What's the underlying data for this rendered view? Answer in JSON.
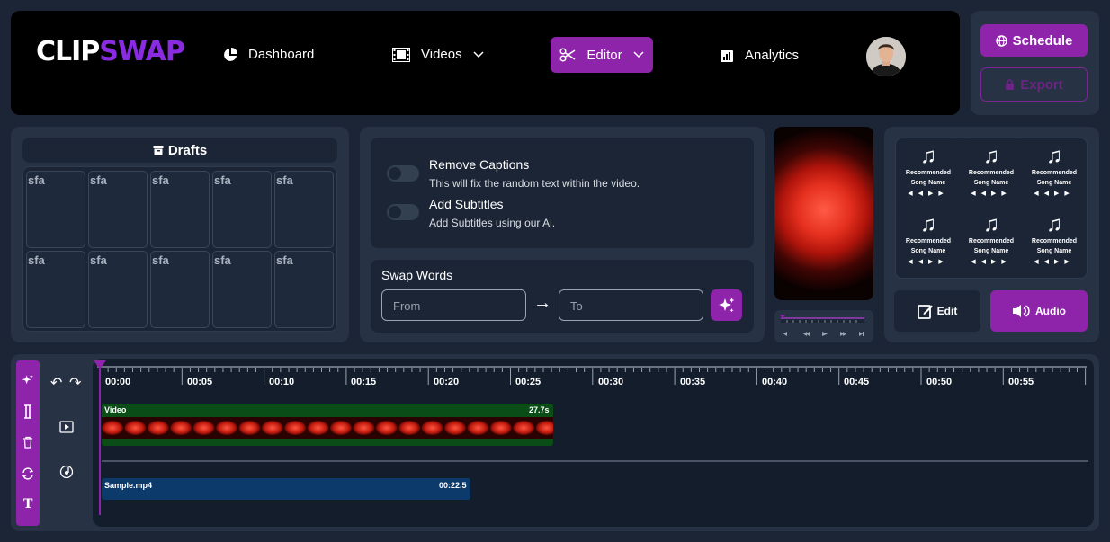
{
  "header": {
    "logo_part1": "CLIP",
    "logo_part2": "SWAP",
    "nav": [
      {
        "label": "Dashboard"
      },
      {
        "label": "Videos"
      },
      {
        "label": "Editor"
      },
      {
        "label": "Analytics"
      }
    ]
  },
  "actions": {
    "schedule_label": "Schedule",
    "export_label": "Export"
  },
  "drafts": {
    "title": "Drafts",
    "items": [
      "sfa",
      "sfa",
      "sfa",
      "sfa",
      "sfa",
      "sfa",
      "sfa",
      "sfa",
      "sfa",
      "sfa"
    ]
  },
  "options": {
    "remove_captions_title": "Remove Captions",
    "remove_captions_desc": "This will fix the random text within the video.",
    "add_subtitles_title": "Add Subtitles",
    "add_subtitles_desc": "Add Subtitles using our Ai."
  },
  "swap_words": {
    "title": "Swap Words",
    "from_placeholder": "From",
    "to_placeholder": "To",
    "arrow": "→"
  },
  "music": {
    "songs": [
      {
        "line1": "Recommended",
        "line2": "Song Name"
      },
      {
        "line1": "Recommended",
        "line2": "Song Name"
      },
      {
        "line1": "Recommended",
        "line2": "Song Name"
      },
      {
        "line1": "Recommended",
        "line2": "Song Name"
      },
      {
        "line1": "Recommended",
        "line2": "Song Name"
      },
      {
        "line1": "Recommended",
        "line2": "Song Name"
      }
    ],
    "edit_label": "Edit",
    "audio_label": "Audio"
  },
  "timeline": {
    "ticks": [
      "00:00",
      "00:05",
      "00:10",
      "00:15",
      "00:20",
      "00:25",
      "00:30",
      "00:35",
      "00:40",
      "00:45",
      "00:50",
      "00:55"
    ],
    "video_track_label": "Video",
    "video_track_duration": "27.7s",
    "audio_clip_label": "Sample.mp4",
    "audio_clip_duration": "00:22.5"
  },
  "colors": {
    "accent": "#8e24aa",
    "background": "#1b2535",
    "panel": "#273245",
    "video_track": "#0b4d16",
    "audio_track": "#0c3a6a"
  }
}
